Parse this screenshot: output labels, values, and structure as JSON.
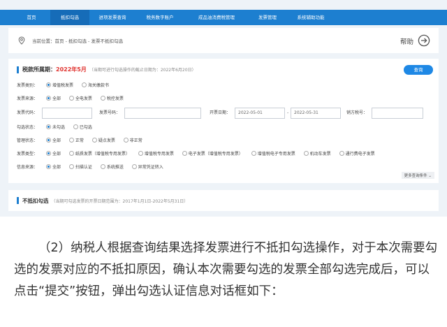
{
  "nav": {
    "items": [
      "首页",
      "抵扣勾选",
      "进项发票查询",
      "税务数字账户",
      "成品油消费税管理",
      "发票管理",
      "系统辅助功能"
    ]
  },
  "breadcrumb": {
    "text": "当前位置：首页 - 抵扣勾选 - 发票不抵扣勾选"
  },
  "help": {
    "label": "帮助"
  },
  "panel": {
    "title": "税款所属期：",
    "period": "2022年5月",
    "note": "（当期可进行勾选操作的截止日期为：2022年6月20日）",
    "query_button": "查询",
    "invoice_category": {
      "label": "发票类别：",
      "options": [
        "增值税发票",
        "海关缴款书"
      ],
      "selected": 0
    },
    "invoice_source": {
      "label": "发票来源：",
      "options": [
        "全部",
        "全电发票",
        "税控发票"
      ],
      "selected": 0
    },
    "fields": {
      "invoice_code_label": "发票代码：",
      "invoice_number_label": "发票号码：",
      "issue_date_label": "开票日期：",
      "date_from": "2022-05-01",
      "date_sep": "-",
      "date_to": "2022-05-31",
      "seller_tax_label": "销方税号："
    },
    "check_status": {
      "label": "勾选状态：",
      "options": [
        "未勾选",
        "已勾选"
      ],
      "selected": 0
    },
    "mgmt_status": {
      "label": "管理状态：",
      "options": [
        "全部",
        "正常",
        "疑点发票",
        "非正常"
      ],
      "selected": 0
    },
    "invoice_type": {
      "label": "发票类型：",
      "options": [
        "全部",
        "纸质发票（增值税专用发票）",
        "增值税专用发票",
        "电子发票（增值税专用发票）",
        "增值税电子专用发票",
        "机动车发票",
        "通行费电子发票"
      ],
      "selected": 0
    },
    "info_source": {
      "label": "信息来源：",
      "options": [
        "全部",
        "扫描认证",
        "系统推送",
        "异常凭证转入"
      ],
      "selected": 0
    },
    "more_conditions": "更多查询条件"
  },
  "panel2": {
    "title": "不抵扣勾选",
    "note": "（当期可勾选发票的开票日期范围为：2017年1月1日-2022年5月31日）"
  },
  "paragraph": "（2）纳税人根据查询结果选择发票进行不抵扣勾选操作，对于本次需要勾选的发票对应的不抵扣原因，确认本次需要勾选的发票全部勾选完成后，可以点击“提交”按钮，弹出勾选认证信息对话框如下：",
  "colors": {
    "nav": "#1d7fd0",
    "accent": "#1e88e5",
    "period": "#e0332f"
  }
}
